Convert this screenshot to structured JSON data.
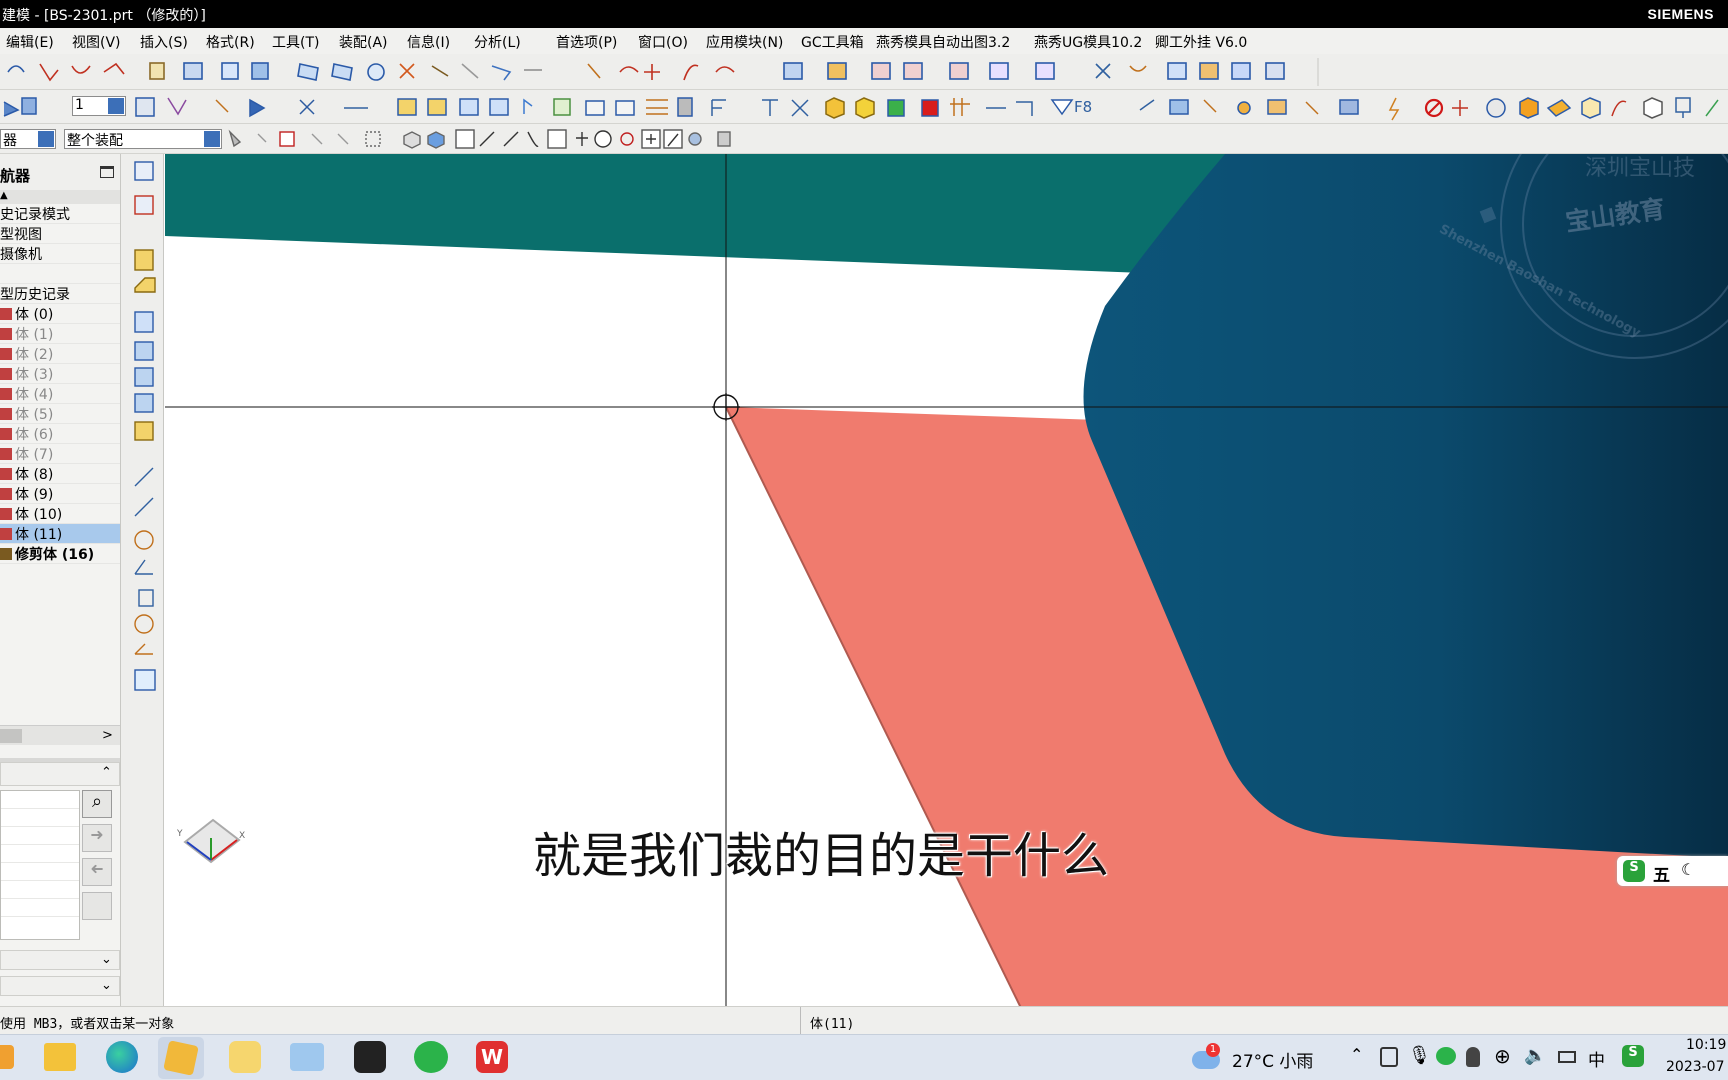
{
  "window": {
    "title": "建模 - [BS-2301.prt （修改的）]",
    "brand": "SIEMENS"
  },
  "menu": {
    "items": [
      "编辑(E)",
      "视图(V)",
      "插入(S)",
      "格式(R)",
      "工具(T)",
      "装配(A)",
      "信息(I)",
      "分析(L)",
      "首选项(P)",
      "窗口(O)",
      "应用模块(N)",
      "GC工具箱",
      "燕秀模具自动出图3.2",
      "燕秀UG模具10.2",
      "卿工外挂 V6.0"
    ]
  },
  "toolbar": {
    "layer_value": "1",
    "filter_value": "器",
    "assembly_scope": "整个装配",
    "palette": [
      "#ff00ff",
      "#e8141c",
      "#ff8a00",
      "#c8ff2a",
      "#8fff6b",
      "#19f2ff",
      "#1f8fff",
      "#1523e0",
      "#7a28d6",
      "#96522a",
      "#8fd0d8",
      "#f5a0c8"
    ]
  },
  "navigator": {
    "title": "航器",
    "items": [
      {
        "label": "史记录模式",
        "state": "normal"
      },
      {
        "label": "型视图",
        "state": "normal"
      },
      {
        "label": "摄像机",
        "state": "normal"
      },
      {
        "label": "",
        "state": "normal"
      },
      {
        "label": "型历史记录",
        "state": "normal"
      },
      {
        "label": "体 (0)",
        "state": "normal"
      },
      {
        "label": "体 (1)",
        "state": "dim"
      },
      {
        "label": "体 (2)",
        "state": "dim"
      },
      {
        "label": "体 (3)",
        "state": "dim"
      },
      {
        "label": "体 (4)",
        "state": "dim"
      },
      {
        "label": "体 (5)",
        "state": "dim"
      },
      {
        "label": "体 (6)",
        "state": "dim"
      },
      {
        "label": "体 (7)",
        "state": "dim"
      },
      {
        "label": "体 (8)",
        "state": "normal"
      },
      {
        "label": "体 (9)",
        "state": "normal"
      },
      {
        "label": "体 (10)",
        "state": "normal"
      },
      {
        "label": "体 (11)",
        "state": "selected"
      },
      {
        "label": "修剪体 (16)",
        "state": "bold"
      }
    ]
  },
  "viewport": {
    "colors": {
      "teal": "#0a6f6c",
      "navy": "#0b4a6c",
      "salmon": "#f07b6e"
    },
    "watermark": "宝山教育",
    "watermark_ring": "Shenzhen Baoshan Technology",
    "watermark_top": "深圳宝山技",
    "subtitle": "就是我们裁的目的是干什么",
    "ime": "五"
  },
  "status": {
    "left": "使用 MB3，或者双击某一对象",
    "mid": "体(11)"
  },
  "taskbar": {
    "weather": "27°C 小雨",
    "weather_badge": "1",
    "ime": "中",
    "time": "10:19",
    "date": "2023-07"
  }
}
